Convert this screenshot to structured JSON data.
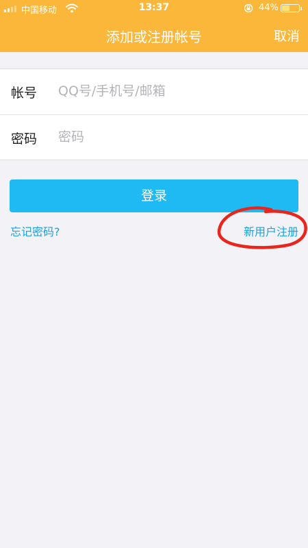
{
  "status_bar": {
    "carrier": "中国移动",
    "time": "13:37",
    "battery_percent": "44%",
    "battery_level": 0.44,
    "signal_icon": "signal-bars-icon",
    "wifi_icon": "wifi-icon",
    "rotation_lock_icon": "rotation-lock-icon"
  },
  "nav": {
    "title": "添加或注册帐号",
    "cancel_label": "取消"
  },
  "form": {
    "account_label": "帐号",
    "account_placeholder": "QQ号/手机号/邮箱",
    "account_value": "",
    "password_label": "密码",
    "password_placeholder": "密码",
    "password_value": ""
  },
  "actions": {
    "login_label": "登录",
    "forgot_label": "忘记密码?",
    "register_label": "新用户注册"
  },
  "colors": {
    "header_bg": "#fbb73a",
    "button_bg": "#1fbaf3",
    "link": "#1ba1de",
    "annotation": "#e8261e"
  }
}
